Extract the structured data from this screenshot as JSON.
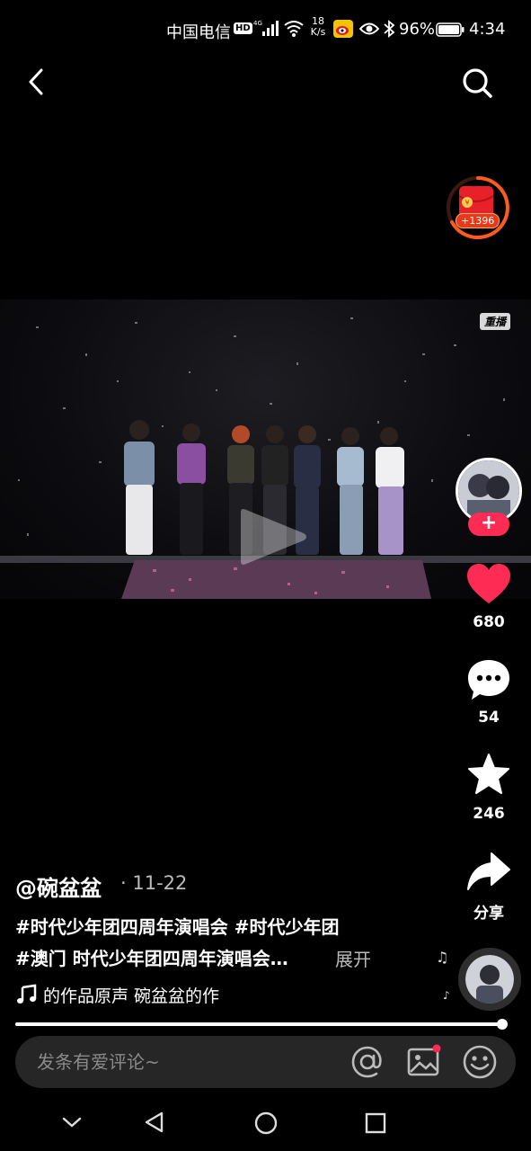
{
  "status_bar": {
    "carrier": "中国电信",
    "hd": "HD",
    "network": "4G",
    "speed_value": "18",
    "speed_unit": "K/s",
    "battery": "96%",
    "time": "4:34"
  },
  "header": {
    "back_icon": "back-chevron-icon",
    "search_icon": "search-icon"
  },
  "reward": {
    "amount": "+1396"
  },
  "video": {
    "replay_badge": "重播",
    "progress": 0.99
  },
  "rail": {
    "likes": "680",
    "comments": "54",
    "favorites": "246",
    "share": "分享"
  },
  "caption": {
    "author": "@碗盆盆",
    "date": "· 11-22",
    "line1": "#时代少年团四周年演唱会 #时代少年团",
    "line2": "#澳门 时代少年团四周年演唱会…",
    "expand": "展开",
    "music": "的作品原声     碗盆盆的作"
  },
  "comment_bar": {
    "placeholder": "发条有爱评论~"
  },
  "colors": {
    "like": "#fe2c55",
    "accent": "#fe2c55",
    "reward_ring": "#ff5a1f"
  }
}
